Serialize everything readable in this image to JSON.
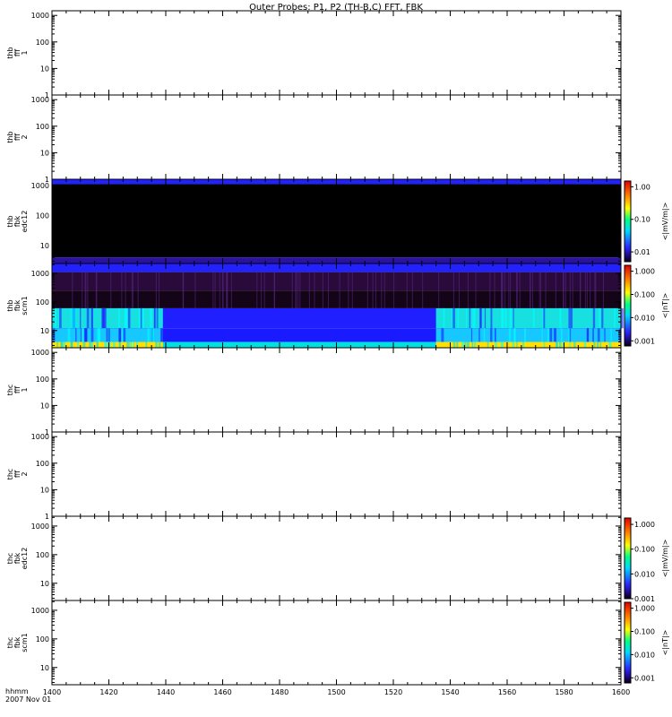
{
  "title": "Outer Probes: P1, P2 (TH-B,C) FFT, FBK",
  "footer": {
    "line1": "hhmm",
    "line2": "2007 Nov 01"
  },
  "colors": {
    "black": "#000000",
    "blue_cap": "#2222ff",
    "dark_blue": "#2b12a0"
  },
  "chart_data": {
    "type": "heatmap",
    "xlim": [
      1400,
      1600
    ],
    "x_ticks": [
      1400,
      1420,
      1440,
      1460,
      1480,
      1500,
      1520,
      1540,
      1560,
      1580,
      1600
    ],
    "x_tick_labels": [
      "1400",
      "1420",
      "1440",
      "1460",
      "1480",
      "1500",
      "1520",
      "1540",
      "1560",
      "1580",
      "1600"
    ],
    "yscale": "log",
    "panels": [
      {
        "label": [
          "thb",
          "fff",
          "1"
        ],
        "ylim": [
          1,
          1500
        ],
        "y_ticks": [
          1,
          10,
          100,
          1000
        ],
        "y_tick_labels": [
          "1",
          "10",
          "100",
          "1000"
        ],
        "data": "none"
      },
      {
        "label": [
          "thb",
          "fff",
          "2"
        ],
        "ylim": [
          1,
          1500
        ],
        "y_ticks": [
          1,
          10,
          100,
          1000
        ],
        "y_tick_labels": [
          "1",
          "10",
          "100",
          "1000"
        ],
        "data": "none"
      },
      {
        "label": [
          "thb",
          "fbk",
          "edc12"
        ],
        "ylim": [
          2.5,
          1600
        ],
        "y_ticks": [
          10,
          100,
          1000
        ],
        "y_tick_labels": [
          "10",
          "100",
          "1000"
        ],
        "colorbar": {
          "title": "<|mV/m|>",
          "scale": "log",
          "range": [
            0.005,
            1.5
          ],
          "ticks": [
            0.01,
            0.1,
            1
          ],
          "tick_labels": [
            "0.01",
            "0.10",
            "1.00"
          ]
        },
        "bands": [
          {
            "f_range": [
              1100,
              1600
            ],
            "level": "mid-low",
            "color": "#2222ff"
          },
          {
            "f_range": [
              4,
              1100
            ],
            "level": "below range",
            "color": "#000000"
          },
          {
            "f_range": [
              2.5,
              4
            ],
            "level": "low",
            "color": "#2b12a0"
          }
        ]
      },
      {
        "label": [
          "thb",
          "fbk",
          "scm1"
        ],
        "ylim": [
          2.5,
          2200
        ],
        "y_ticks": [
          10,
          100,
          1000
        ],
        "y_tick_labels": [
          "10",
          "100",
          "1000"
        ],
        "colorbar": {
          "title": "<|nT|>",
          "scale": "log",
          "range": [
            0.0006,
            1.8
          ],
          "ticks": [
            0.001,
            0.01,
            0.1,
            1
          ],
          "tick_labels": [
            "0.001",
            "0.010",
            "0.100",
            "1.000"
          ]
        },
        "active_intervals": [
          [
            1400,
            1439
          ],
          [
            1535,
            1600
          ]
        ],
        "bands": [
          {
            "f_range": [
              1100,
              2200
            ],
            "color": "#2222ff"
          },
          {
            "f_range": [
              250,
              1100
            ],
            "color": "#2a0a3a"
          },
          {
            "f_range": [
              60,
              250
            ],
            "color": "#140418"
          },
          {
            "f_range": [
              12,
              60
            ],
            "color": "#1f1fff",
            "active_color": "#18e0e0"
          },
          {
            "f_range": [
              4,
              12
            ],
            "color": "#1a1aff",
            "active_color": "#16c8ff"
          },
          {
            "f_range": [
              2.5,
              4
            ],
            "color": "#00e0e0",
            "active_color": "#ffe000"
          }
        ]
      },
      {
        "label": [
          "thc",
          "fff",
          "1"
        ],
        "ylim": [
          1,
          1500
        ],
        "y_ticks": [
          1,
          10,
          100,
          1000
        ],
        "y_tick_labels": [
          "1",
          "10",
          "100",
          "1000"
        ],
        "data": "none"
      },
      {
        "label": [
          "thc",
          "fff",
          "2"
        ],
        "ylim": [
          1,
          1500
        ],
        "y_ticks": [
          1,
          10,
          100,
          1000
        ],
        "y_tick_labels": [
          "1",
          "10",
          "100",
          "1000"
        ],
        "data": "none"
      },
      {
        "label": [
          "thc",
          "fbk",
          "edc12"
        ],
        "ylim": [
          2.5,
          2200
        ],
        "y_ticks": [
          10,
          100,
          1000
        ],
        "y_tick_labels": [
          "10",
          "100",
          "1000"
        ],
        "colorbar": {
          "title": "<|mV/m|>",
          "scale": "log",
          "range": [
            0.001,
            1.8
          ],
          "ticks": [
            0.001,
            0.01,
            0.1,
            1
          ],
          "tick_labels": [
            "0.001",
            "0.010",
            "0.100",
            "1.000"
          ]
        },
        "data": "none"
      },
      {
        "label": [
          "thc",
          "fbk",
          "scm1"
        ],
        "ylim": [
          2.5,
          2200
        ],
        "y_ticks": [
          10,
          100,
          1000
        ],
        "y_tick_labels": [
          "10",
          "100",
          "1000"
        ],
        "colorbar": {
          "title": "<|nT|>",
          "scale": "log",
          "range": [
            0.0006,
            1.8
          ],
          "ticks": [
            0.001,
            0.01,
            0.1,
            1
          ],
          "tick_labels": [
            "0.001",
            "0.010",
            "0.100",
            "1.000"
          ]
        },
        "data": "none"
      }
    ]
  }
}
